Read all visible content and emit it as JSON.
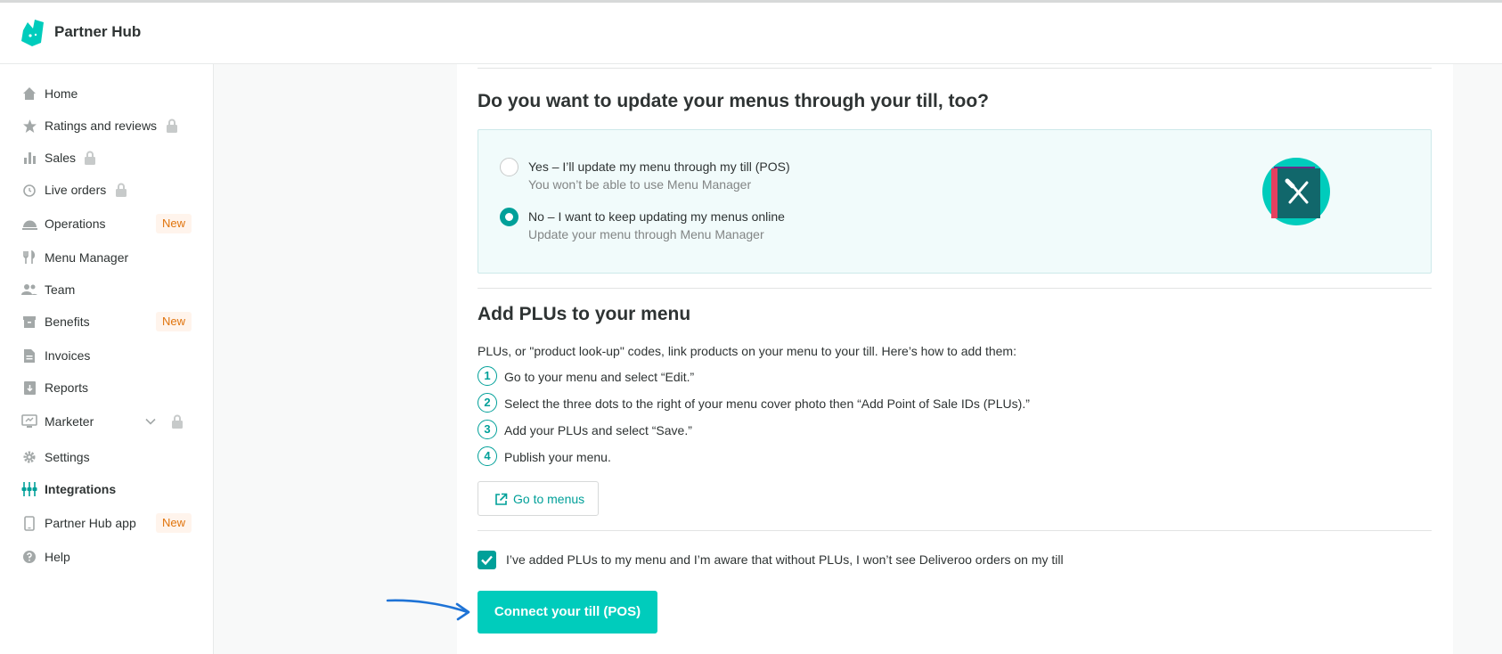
{
  "header": {
    "brand": "Partner Hub",
    "logo_icon": "deliveroo-kangaroo-logo"
  },
  "colors": {
    "accent": "#00ccbc",
    "accent_dark": "#00a099",
    "new_badge": "#e0740d"
  },
  "sidebar": {
    "items": [
      {
        "label": "Home",
        "icon": "home-icon"
      },
      {
        "label": "Ratings and reviews",
        "icon": "star-icon",
        "locked": true
      },
      {
        "label": "Sales",
        "icon": "bar-chart-icon",
        "locked": true
      },
      {
        "label": "Live orders",
        "icon": "clock-icon",
        "locked": true
      },
      {
        "label": "Operations",
        "icon": "cloche-icon",
        "badge": "New"
      },
      {
        "label": "Menu Manager",
        "icon": "cutlery-icon"
      },
      {
        "label": "Team",
        "icon": "people-icon"
      },
      {
        "label": "Benefits",
        "icon": "archive-icon",
        "badge": "New"
      },
      {
        "label": "Invoices",
        "icon": "document-icon"
      },
      {
        "label": "Reports",
        "icon": "report-download-icon"
      },
      {
        "label": "Marketer",
        "icon": "monitor-icon",
        "locked": true,
        "expandable": true
      },
      {
        "label": "Settings",
        "icon": "gear-icon"
      },
      {
        "label": "Integrations",
        "icon": "integrations-icon",
        "active": true
      },
      {
        "label": "Partner Hub app",
        "icon": "phone-icon",
        "badge": "New"
      },
      {
        "label": "Help",
        "icon": "help-icon"
      }
    ]
  },
  "till_section": {
    "heading": "Do you want to update your menus through your till, too?",
    "options": [
      {
        "title": "Yes – I’ll update my menu through my till (POS)",
        "subtitle": "You won’t be able to use Menu Manager",
        "selected": false
      },
      {
        "title": "No – I want to keep updating my menus online",
        "subtitle": "Update your menu through Menu Manager",
        "selected": true
      }
    ],
    "illustration": "menu-book-cutlery-icon"
  },
  "plu_section": {
    "heading": "Add PLUs to your menu",
    "intro": "PLUs, or \"product look-up\" codes, link products on your menu to your till. Here’s how to add them:",
    "steps": [
      {
        "num": "1",
        "text": "Go to your menu and select “Edit.”"
      },
      {
        "num": "2",
        "text": "Select the three dots to the right of your menu cover photo then “Add Point of Sale IDs (PLUs).”"
      },
      {
        "num": "3",
        "text": "Add your PLUs and select “Save.”"
      },
      {
        "num": "4",
        "text": "Publish your menu."
      }
    ],
    "go_to_menus": "Go to menus"
  },
  "confirm": {
    "checkbox_label": "I’ve added PLUs to my menu and I’m aware that without PLUs, I won’t see Deliveroo orders on my till",
    "checked": true
  },
  "connect_button": "Connect your till (POS)"
}
